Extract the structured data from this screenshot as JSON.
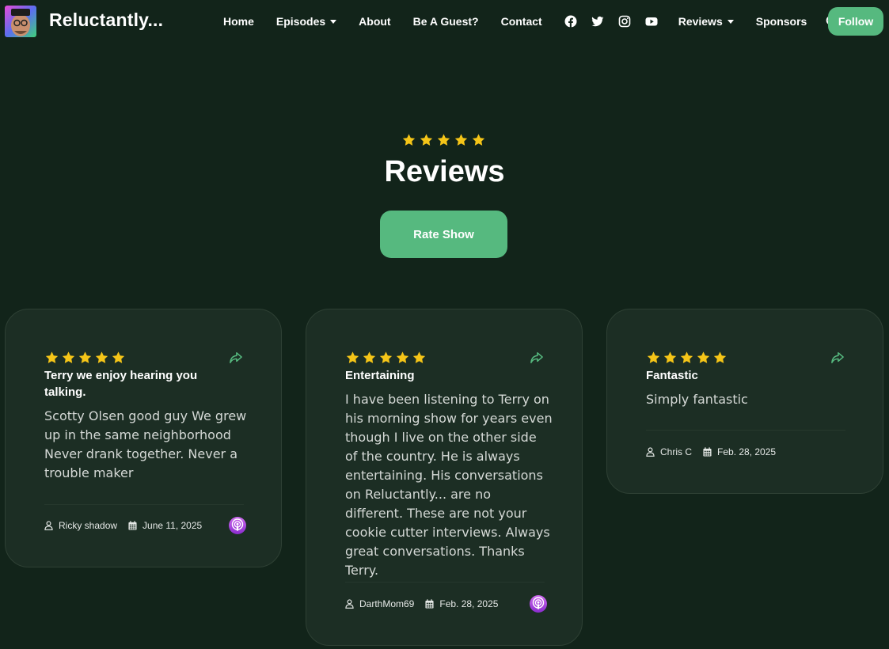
{
  "nav": {
    "brand": "Reluctantly...",
    "logo_text": "RELUCTANTLY",
    "links": [
      {
        "label": "Home",
        "dropdown": false
      },
      {
        "label": "Episodes",
        "dropdown": true
      },
      {
        "label": "About",
        "dropdown": false
      },
      {
        "label": "Be A Guest?",
        "dropdown": false
      },
      {
        "label": "Contact",
        "dropdown": false
      }
    ],
    "social_icons": [
      "facebook-icon",
      "twitter-icon",
      "instagram-icon",
      "youtube-icon"
    ],
    "links_after": [
      {
        "label": "Reviews",
        "dropdown": true
      },
      {
        "label": "Sponsors",
        "dropdown": false
      }
    ],
    "search_icon": "search-icon",
    "follow_label": "Follow"
  },
  "hero": {
    "rating": 5,
    "title": "Reviews",
    "rate_button": "Rate Show"
  },
  "reviews": [
    {
      "rating": 5,
      "title": "Terry we enjoy hearing you talking.",
      "body": "Scotty Olsen good guy We grew up in the same neighborhood Never drank together. Never a trouble maker",
      "author": "Ricky shadow",
      "date": "June 11, 2025",
      "source_icon": "apple-podcasts-icon"
    },
    {
      "rating": 5,
      "title": "Entertaining",
      "body": "I have been listening to Terry on his morning show for years even though I live on the other side of the country. He is always entertaining. His conversations on Reluctantly... are no different. These are not your cookie cutter interviews. Always great conversations. Thanks Terry.",
      "author": "DarthMom69",
      "date": "Feb. 28, 2025",
      "source_icon": "apple-podcasts-icon"
    },
    {
      "rating": 5,
      "title": "Fantastic",
      "body": "Simply fantastic",
      "author": "Chris C",
      "date": "Feb. 28, 2025",
      "source_icon": null
    }
  ],
  "colors": {
    "background": "#12241a",
    "card": "#1c2e24",
    "accent": "#56b97f",
    "star": "#f5c518"
  }
}
